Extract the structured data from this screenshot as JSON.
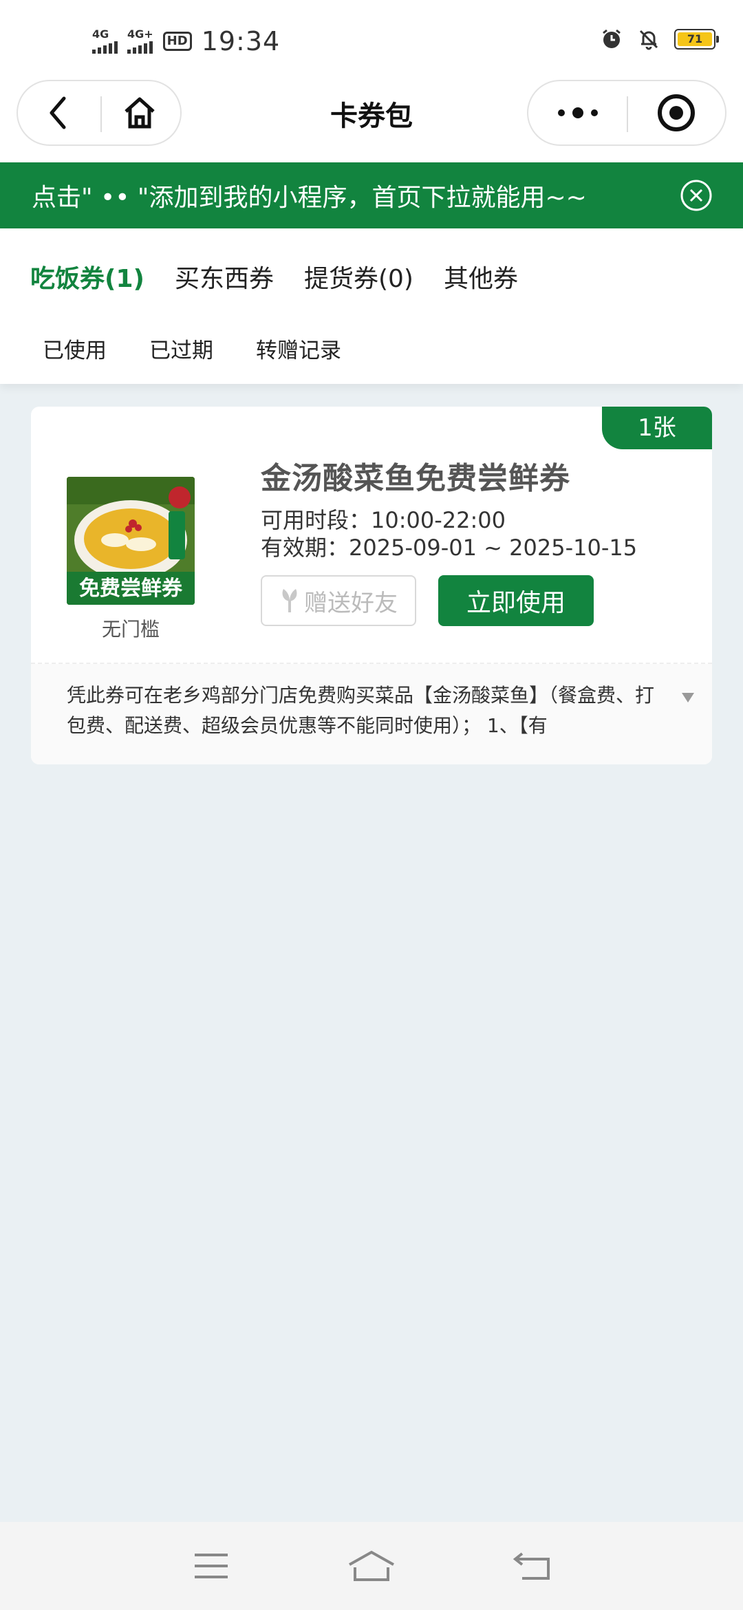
{
  "status_bar": {
    "network_1": "4G",
    "network_2": "4G+",
    "hd_label": "HD",
    "time": "19:34",
    "battery": "71"
  },
  "header": {
    "title": "卡券包"
  },
  "banner": {
    "text": "点击\" •• \"添加到我的小程序，首页下拉就能用~~"
  },
  "tabs": [
    {
      "label": "吃饭券(1)"
    },
    {
      "label": "买东西券"
    },
    {
      "label": "提货券(0)"
    },
    {
      "label": "其他券"
    }
  ],
  "subtabs": [
    {
      "label": "已使用"
    },
    {
      "label": "已过期"
    },
    {
      "label": "转赠记录"
    }
  ],
  "coupon": {
    "count": "1张",
    "image_text": "免费尝鲜券",
    "threshold": "无门槛",
    "title": "金汤酸菜鱼免费尝鲜券",
    "time_range": "可用时段：10:00-22:00",
    "validity": "有效期：2025-09-01 ~ 2025-10-15",
    "gift_label": "赠送好友",
    "use_label": "立即使用",
    "description": "凭此券可在老乡鸡部分门店免费购买菜品【金汤酸菜鱼】（餐盒费、打包费、配送费、超级会员优惠等不能同时使用）； 1、【有"
  },
  "colors": {
    "brand_green": "#12843f",
    "background": "#eaf0f3"
  }
}
